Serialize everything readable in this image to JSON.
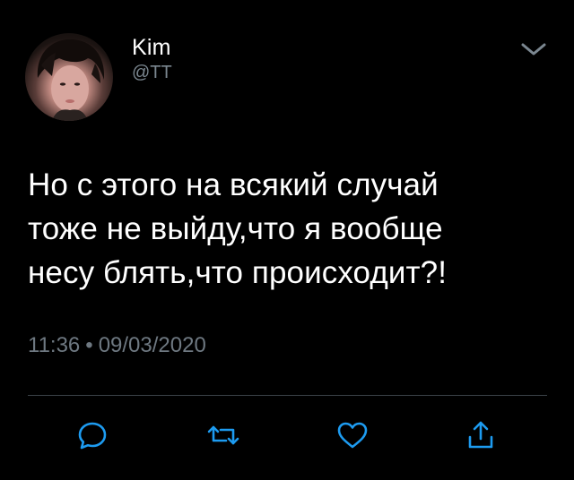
{
  "tweet": {
    "display_name": "Kim",
    "handle": "@TT",
    "text": "Но с этого на всякий случай\nтоже не выйду,что я вообще\nнесу блять,что происходит?!",
    "time": "11:36",
    "separator": "•",
    "date": "09/03/2020"
  },
  "colors": {
    "background": "#000000",
    "text": "#ffffff",
    "secondary": "#6e7881",
    "icon": "#1d9bf0"
  },
  "icons": {
    "menu": "chevron-down-icon",
    "reply": "reply-icon",
    "retweet": "retweet-icon",
    "like": "heart-icon",
    "share": "share-icon"
  }
}
